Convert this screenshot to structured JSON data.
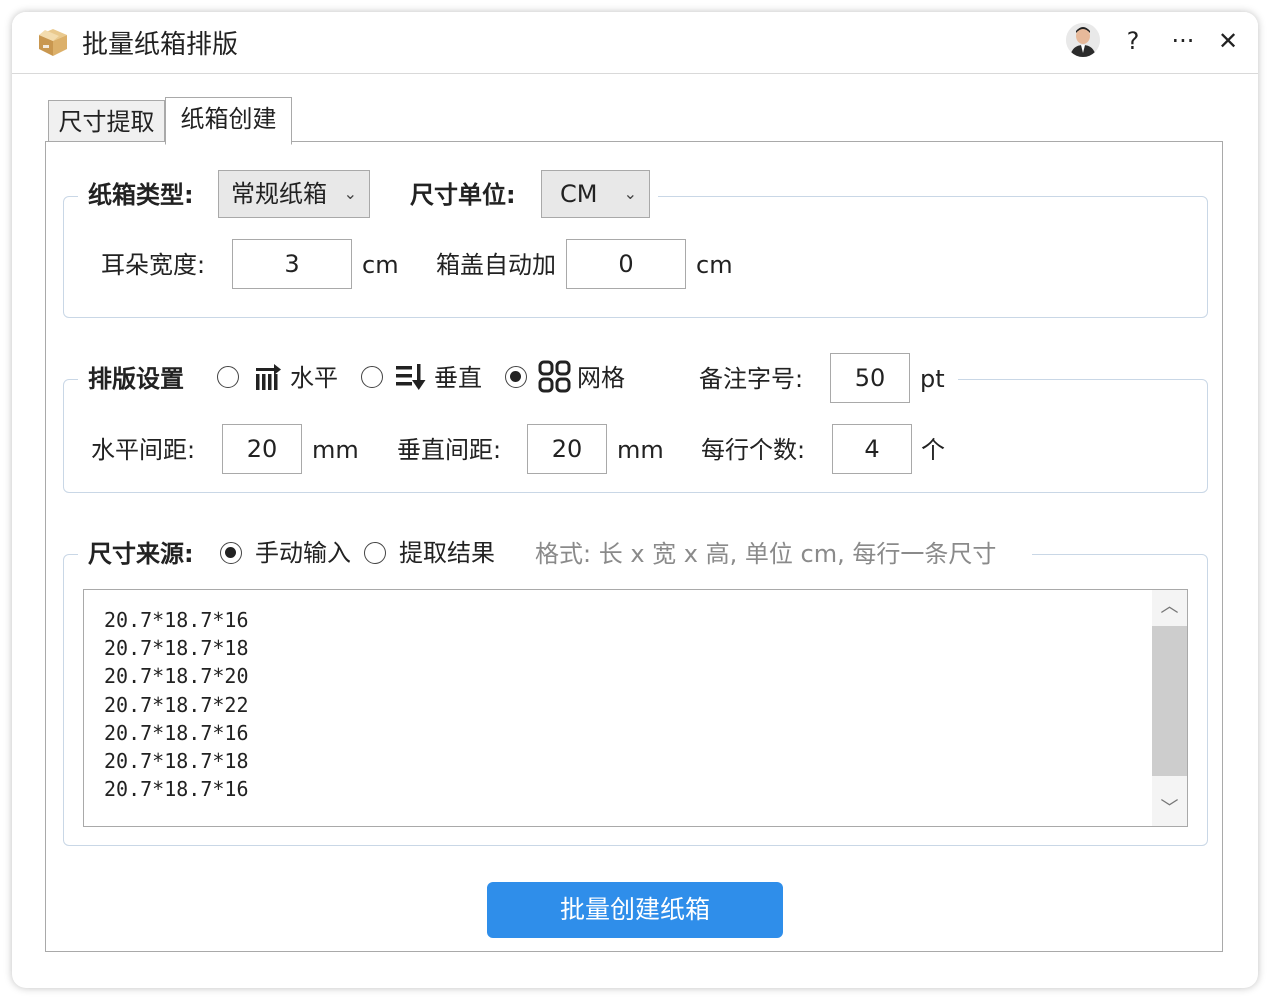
{
  "window": {
    "title": "批量纸箱排版",
    "help_label": "?",
    "more_label": "···",
    "close_label": "✕"
  },
  "tabs": [
    {
      "label": "尺寸提取",
      "active": false
    },
    {
      "label": "纸箱创建",
      "active": true
    }
  ],
  "box_group": {
    "type_label": "纸箱类型:",
    "type_value": "常规纸箱",
    "unit_label": "尺寸单位:",
    "unit_value": "CM",
    "ear_width_label": "耳朵宽度:",
    "ear_width_value": "3",
    "ear_width_unit": "cm",
    "lid_label": "箱盖自动加",
    "lid_value": "0",
    "lid_unit": "cm"
  },
  "layout_group": {
    "title": "排版设置",
    "options": [
      {
        "label": "水平",
        "icon": "horizontal-layout-icon",
        "checked": false
      },
      {
        "label": "垂直",
        "icon": "vertical-layout-icon",
        "checked": false
      },
      {
        "label": "网格",
        "icon": "grid-layout-icon",
        "checked": true
      }
    ],
    "note_font_label": "备注字号:",
    "note_font_value": "50",
    "note_font_unit": "pt",
    "h_spacing_label": "水平间距:",
    "h_spacing_value": "20",
    "h_spacing_unit": "mm",
    "v_spacing_label": "垂直间距:",
    "v_spacing_value": "20",
    "v_spacing_unit": "mm",
    "per_row_label": "每行个数:",
    "per_row_value": "4",
    "per_row_unit": "个"
  },
  "source_group": {
    "title": "尺寸来源:",
    "options": [
      {
        "label": "手动输入",
        "checked": true
      },
      {
        "label": "提取结果",
        "checked": false
      }
    ],
    "format_hint": "格式: 长 x 宽 x 高, 单位 cm, 每行一条尺寸",
    "lines": [
      "20.7*18.7*16",
      "20.7*18.7*18",
      "20.7*18.7*20",
      "20.7*18.7*22",
      "20.7*18.7*16",
      "20.7*18.7*18",
      "20.7*18.7*16"
    ]
  },
  "submit_label": "批量创建纸箱",
  "colors": {
    "primary": "#2f8eea",
    "group_border": "#c9d7e6"
  }
}
